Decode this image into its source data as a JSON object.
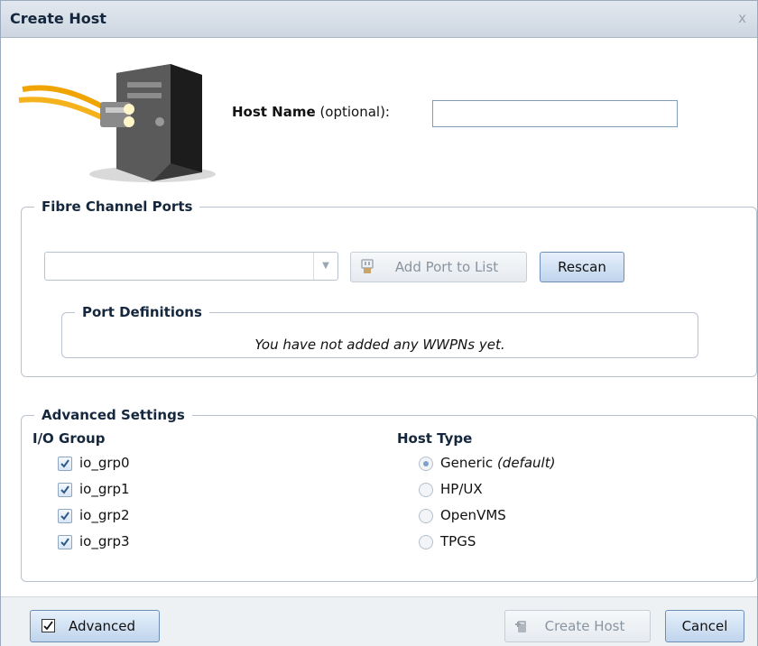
{
  "dialog": {
    "title": "Create Host",
    "close_label": "x"
  },
  "host": {
    "name_label": "Host Name",
    "name_suffix": " (optional):",
    "name_value": ""
  },
  "fibre_channel": {
    "legend": "Fibre Channel Ports",
    "port_select_value": "",
    "add_port_label": "Add Port to List",
    "rescan_label": "Rescan",
    "port_definitions": {
      "legend": "Port Definitions",
      "empty_message": "You have not added any WWPNs yet."
    }
  },
  "advanced": {
    "legend": "Advanced Settings",
    "io_group_heading": "I/O Group",
    "io_groups": [
      {
        "label": "io_grp0",
        "checked": true
      },
      {
        "label": "io_grp1",
        "checked": true
      },
      {
        "label": "io_grp2",
        "checked": true
      },
      {
        "label": "io_grp3",
        "checked": true
      }
    ],
    "host_type_heading": "Host Type",
    "host_types": [
      {
        "label": "Generic",
        "suffix": "(default)",
        "selected": true
      },
      {
        "label": "HP/UX",
        "selected": false
      },
      {
        "label": "OpenVMS",
        "selected": false
      },
      {
        "label": "TPGS",
        "selected": false
      }
    ]
  },
  "footer": {
    "advanced_label": "Advanced",
    "advanced_checked": true,
    "create_label": "Create Host",
    "create_enabled": false,
    "cancel_label": "Cancel"
  },
  "colors": {
    "title_bar": "#cdd6e1",
    "accent_blue": "#bfd4ec",
    "footer": "#eef1f4"
  },
  "icons": {
    "host": "server-with-fibre-cable-icon",
    "add_port": "port-plug-icon",
    "create": "create-host-icon",
    "close": "close-icon"
  }
}
